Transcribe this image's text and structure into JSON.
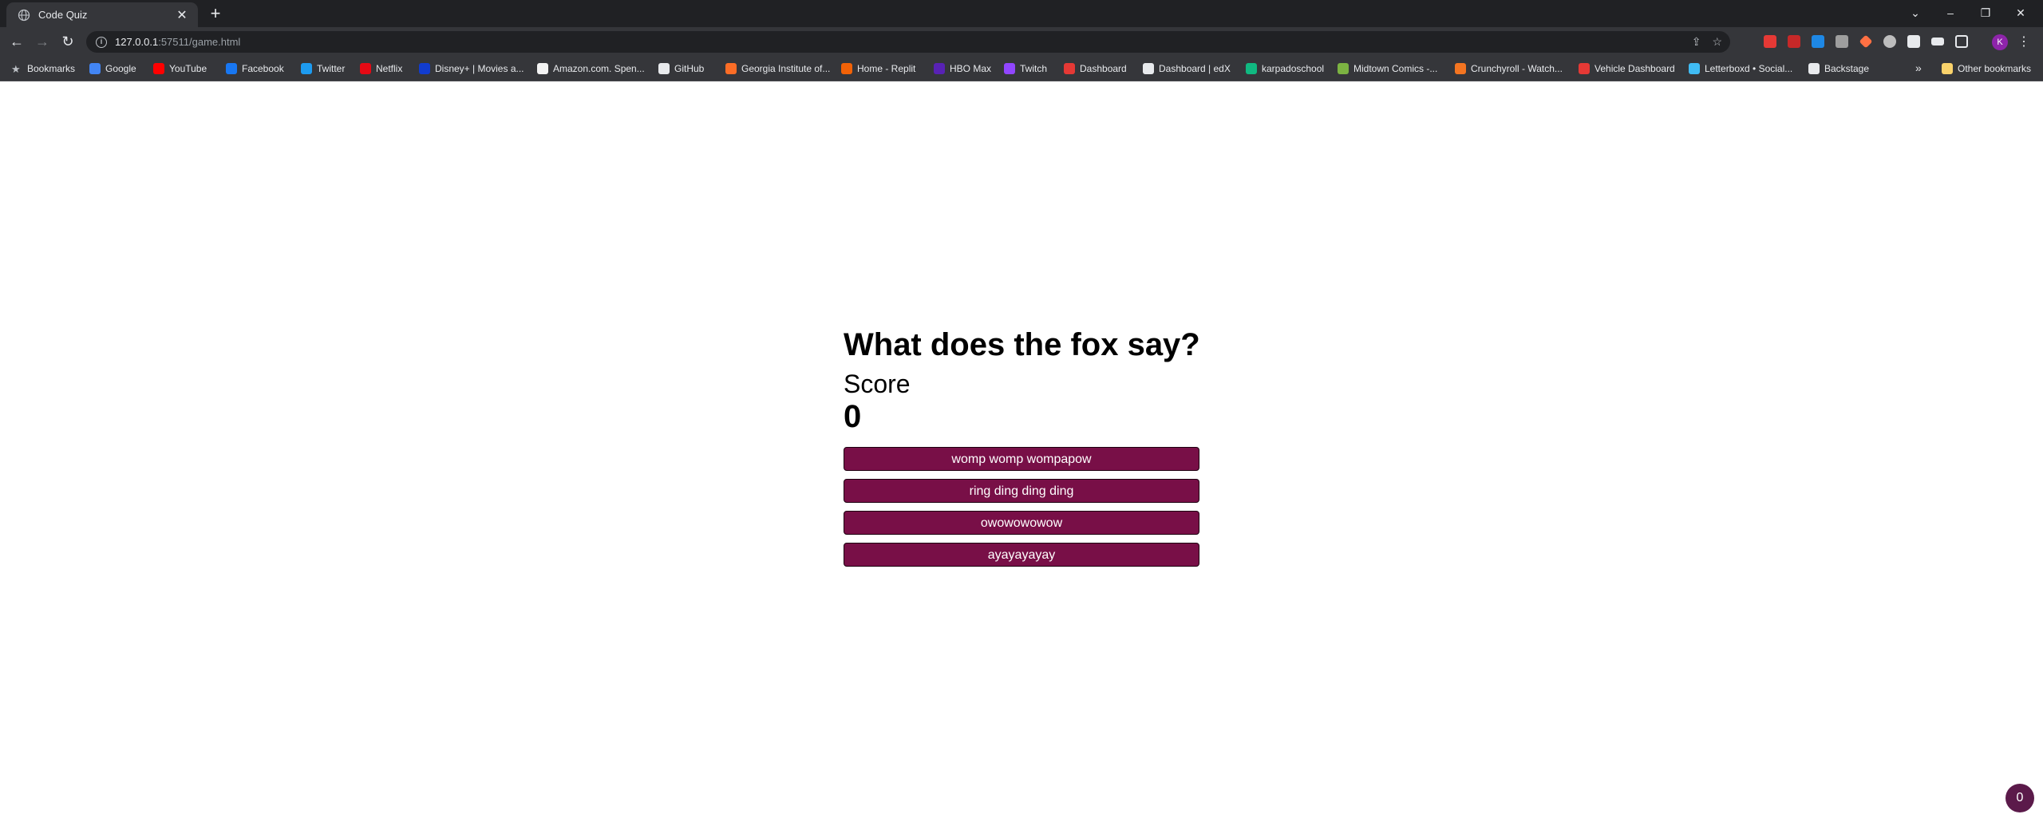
{
  "browser": {
    "tab": {
      "title": "Code Quiz",
      "close": "✕"
    },
    "new_tab": "+",
    "window_controls": {
      "list": "⌄",
      "minimize": "–",
      "restore": "❐",
      "close": "✕"
    },
    "url": {
      "host": "127.0.0.1",
      "path": ":57511/game.html"
    },
    "profile_initial": "K",
    "bookmarks": [
      {
        "label": "Bookmarks",
        "icon": "star-icon",
        "color": "#bdc1c6"
      },
      {
        "label": "Google",
        "icon": "google-icon",
        "color": "#4285f4"
      },
      {
        "label": "YouTube",
        "icon": "youtube-icon",
        "color": "#ff0000"
      },
      {
        "label": "Facebook",
        "icon": "facebook-icon",
        "color": "#1877f2"
      },
      {
        "label": "Twitter",
        "icon": "twitter-icon",
        "color": "#1d9bf0"
      },
      {
        "label": "Netflix",
        "icon": "netflix-icon",
        "color": "#e50914"
      },
      {
        "label": "Disney+ | Movies a...",
        "icon": "disney-icon",
        "color": "#113ccf"
      },
      {
        "label": "Amazon.com. Spen...",
        "icon": "amazon-icon",
        "color": "#f3f3f3"
      },
      {
        "label": "GitHub",
        "icon": "github-icon",
        "color": "#e8eaed"
      },
      {
        "label": "Georgia Institute of...",
        "icon": "gitlab-icon",
        "color": "#fc6d26"
      },
      {
        "label": "Home - Replit",
        "icon": "replit-icon",
        "color": "#f26207"
      },
      {
        "label": "HBO Max",
        "icon": "hbomax-icon",
        "color": "#5822b4"
      },
      {
        "label": "Twitch",
        "icon": "twitch-icon",
        "color": "#9146ff"
      },
      {
        "label": "Dashboard",
        "icon": "dashboard-icon",
        "color": "#e53935"
      },
      {
        "label": "Dashboard | edX",
        "icon": "edx-icon",
        "color": "#e8eaed"
      },
      {
        "label": "karpadoschool",
        "icon": "karpado-icon",
        "color": "#10b981"
      },
      {
        "label": "Midtown Comics -...",
        "icon": "midtown-icon",
        "color": "#7cb342"
      },
      {
        "label": "Crunchyroll - Watch...",
        "icon": "crunchyroll-icon",
        "color": "#f47521"
      },
      {
        "label": "Vehicle Dashboard",
        "icon": "vehicle-icon",
        "color": "#e53935"
      },
      {
        "label": "Letterboxd • Social...",
        "icon": "letterboxd-icon",
        "color": "#40bcf4"
      },
      {
        "label": "Backstage",
        "icon": "backstage-icon",
        "color": "#e8eaed"
      }
    ],
    "overflow": "»",
    "other_bookmarks": "Other bookmarks"
  },
  "quiz": {
    "question": "What does the fox say?",
    "score_label": "Score",
    "score_value": "0",
    "answers": [
      "womp womp wompapow",
      "ring ding ding ding",
      "owowowowow",
      "ayayayayay"
    ]
  },
  "corner_badge": "0",
  "colors": {
    "answer_bg": "#780f47",
    "chrome_dark": "#202124",
    "chrome_mid": "#35363a"
  }
}
